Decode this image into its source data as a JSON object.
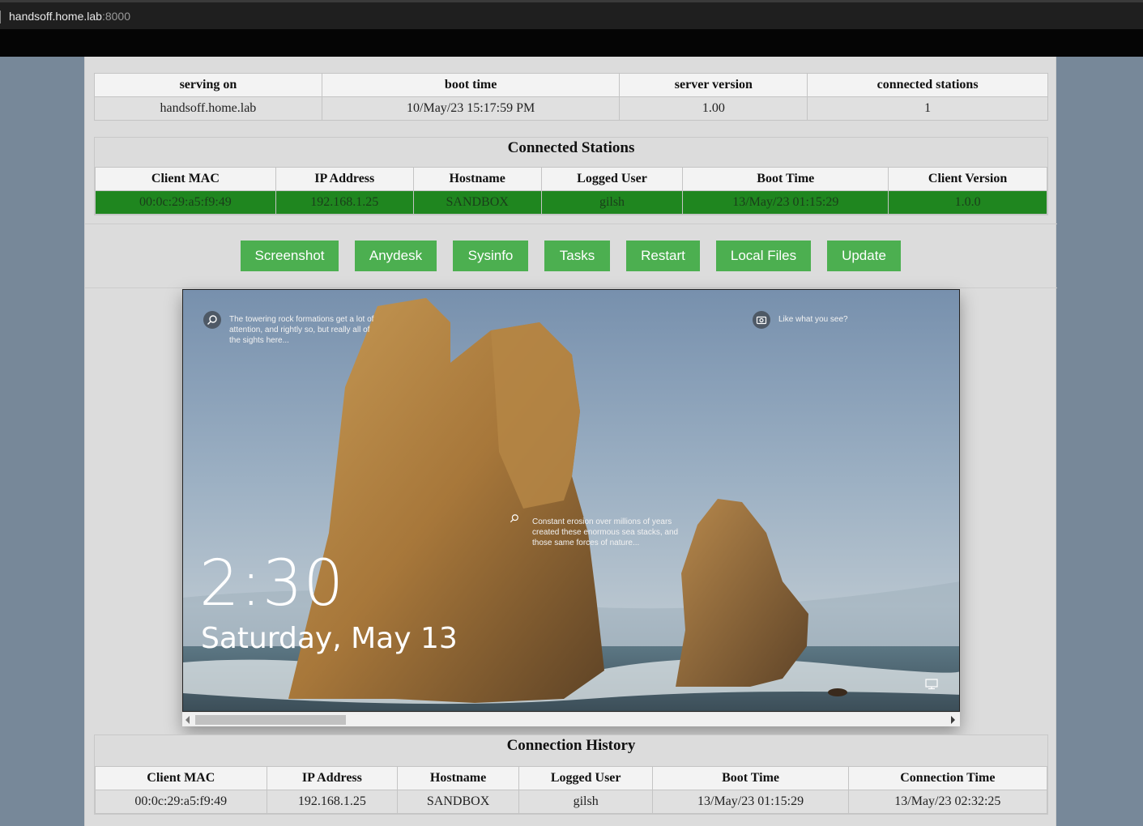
{
  "browser": {
    "host": "handsoff.home.lab",
    "port": ":8000"
  },
  "server_info": {
    "headers": [
      "serving on",
      "boot time",
      "server version",
      "connected stations"
    ],
    "values": [
      "handsoff.home.lab",
      "10/May/23 15:17:59 PM",
      "1.00",
      "1"
    ]
  },
  "connected_stations": {
    "title": "Connected Stations",
    "headers": [
      "Client MAC",
      "IP Address",
      "Hostname",
      "Logged User",
      "Boot Time",
      "Client Version"
    ],
    "rows": [
      [
        "00:0c:29:a5:f9:49",
        "192.168.1.25",
        "SANDBOX",
        "gilsh",
        "13/May/23 01:15:29",
        "1.0.0"
      ]
    ],
    "row_status_color": "#1f861f"
  },
  "actions": {
    "screenshot": "Screenshot",
    "anydesk": "Anydesk",
    "sysinfo": "Sysinfo",
    "tasks": "Tasks",
    "restart": "Restart",
    "local_files": "Local Files",
    "update": "Update",
    "color": "#4caf50"
  },
  "screenshot": {
    "time": "2:30",
    "date": "Saturday, May 13",
    "caption_top": [
      "The towering rock formations get a lot of",
      "attention, and rightly so, but really all of",
      "the sights here..."
    ],
    "caption_right": "Like what you see?",
    "caption_middle": [
      "Constant erosion over millions of years",
      "created these enormous sea stacks, and",
      "those same forces of nature..."
    ],
    "icons": [
      "search-icon",
      "camera-icon",
      "search-icon",
      "network-icon"
    ]
  },
  "connection_history": {
    "title": "Connection History",
    "headers": [
      "Client MAC",
      "IP Address",
      "Hostname",
      "Logged User",
      "Boot Time",
      "Connection Time"
    ],
    "rows": [
      [
        "00:0c:29:a5:f9:49",
        "192.168.1.25",
        "SANDBOX",
        "gilsh",
        "13/May/23 01:15:29",
        "13/May/23 02:32:25"
      ]
    ]
  }
}
